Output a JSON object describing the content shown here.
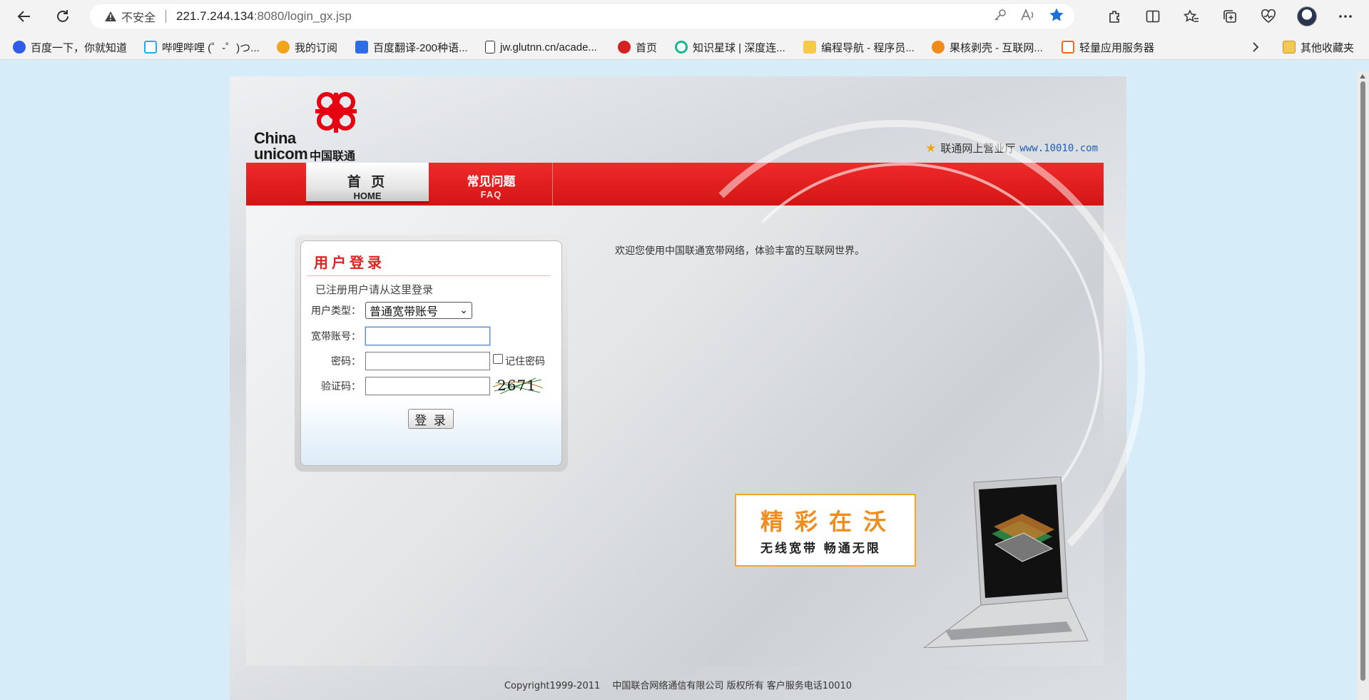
{
  "browser": {
    "address": {
      "insecure_label": "不安全",
      "url_host": "221.7.244.134",
      "url_rest": ":8080/login_gx.jsp"
    },
    "icons": [
      "back-icon",
      "refresh-icon",
      "warning-icon",
      "key-icon",
      "read-aloud-icon",
      "favorite-star-icon",
      "extensions-icon",
      "split-screen-icon",
      "favorites-icon",
      "collections-icon",
      "performance-icon",
      "profile-avatar",
      "more-icon"
    ],
    "bookmarks": [
      {
        "label": "百度一下，你就知道",
        "color": "#2f5ce8"
      },
      {
        "label": "哔哩哔哩 (゜-゜)つ...",
        "color": "#23ade5"
      },
      {
        "label": "我的订阅",
        "color": "#f4a41c"
      },
      {
        "label": "百度翻译-200种语...",
        "color": "#2f6de8"
      },
      {
        "label": "jw.glutnn.cn/acade...",
        "color": "#ffffff"
      },
      {
        "label": "首页",
        "color": "#d22222"
      },
      {
        "label": "知识星球 | 深度连...",
        "color": "#17b890"
      },
      {
        "label": "编程导航 - 程序员...",
        "color": "#f7c948"
      },
      {
        "label": "果核剥壳 - 互联网...",
        "color": "#f08a1c"
      },
      {
        "label": "轻量应用服务器",
        "color": "#f06a1c"
      }
    ],
    "other_bookmarks": "其他收藏夹"
  },
  "page": {
    "logo": {
      "english": "China\nunicom",
      "chinese": "中国联通"
    },
    "top_link": {
      "label": "联通网上营业厅",
      "site": "www.10010.com"
    },
    "nav": {
      "home": {
        "cn": "首 页",
        "en": "HOME"
      },
      "faq": {
        "cn": "常见问题",
        "en": "FAQ"
      }
    },
    "login": {
      "title": "用户登录",
      "subtitle": "已注册用户请从这里登录",
      "user_type_label": "用户类型：",
      "user_type_value": "普通宽带账号",
      "account_label": "宽带账号：",
      "account_value": "",
      "password_label": "密码：",
      "password_value": "",
      "remember_label": "记住密码",
      "captcha_label": "验证码：",
      "captcha_value": "",
      "captcha_image_text": "2671",
      "submit_label": "登 录"
    },
    "welcome": "欢迎您使用中国联通宽带网络，体验丰富的互联网世界。",
    "ad": {
      "headline": "精彩在沃",
      "tagline": "无线宽带 畅通无限"
    },
    "footer": "Copyright1999-2011　 中国联合网络通信有限公司  版权所有   客户服务电话10010"
  },
  "colors": {
    "brand_red": "#e02020",
    "nav_red": "#d41414",
    "ad_orange": "#f08c1c",
    "link_blue": "#1f5fb8",
    "page_bg": "#d6ecf8"
  }
}
